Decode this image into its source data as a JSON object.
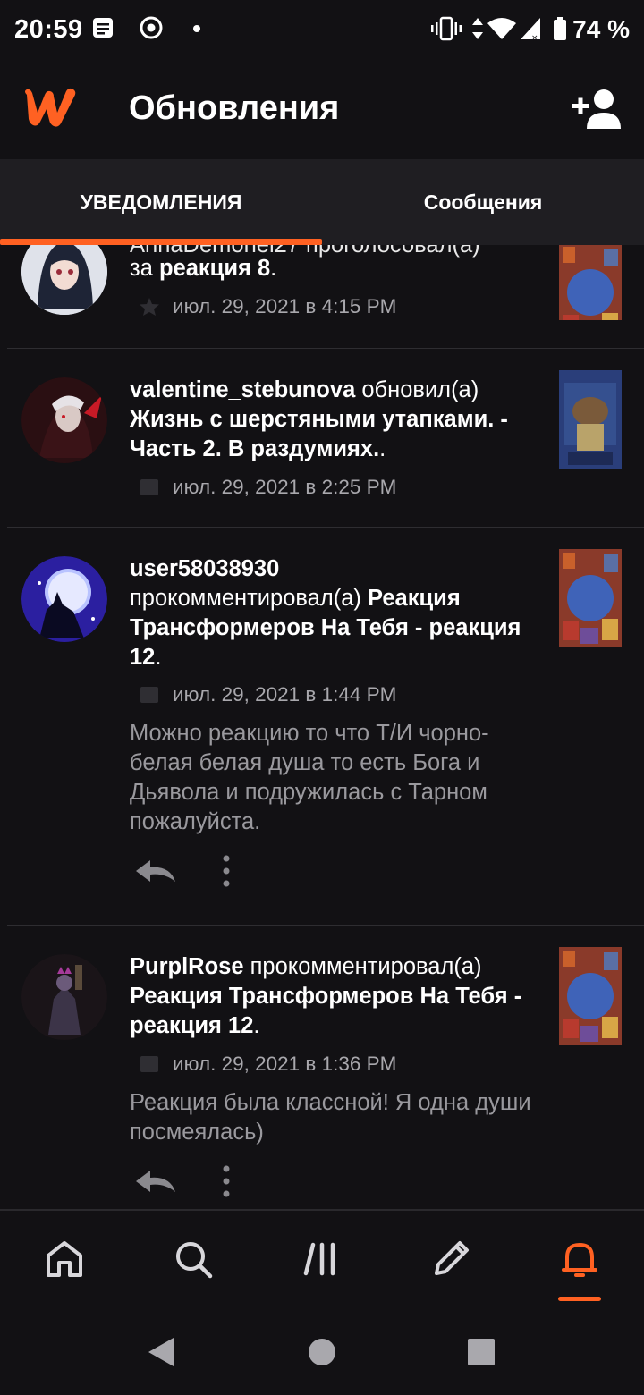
{
  "status_bar": {
    "time": "20:59",
    "battery_percent": "74 %",
    "icons": [
      "notification-icon",
      "chrome-icon",
      "dot-icon",
      "vibrate-icon",
      "data-arrows-icon",
      "wifi-icon",
      "signal-icon",
      "battery-icon"
    ]
  },
  "app_bar": {
    "title": "Обновления",
    "logo": "wattpad-logo",
    "action_icon": "add-user-icon"
  },
  "tabs": [
    {
      "label": "УВЕДОМЛЕНИЯ",
      "active": true
    },
    {
      "label": "Сообщения",
      "active": false
    }
  ],
  "notifications": [
    {
      "partial_top_text": "AnnaDemonel27 проголосовал(а)",
      "prefix": "за",
      "title": "реакция 8",
      "suffix": ".",
      "timestamp": "июл. 29, 2021 в 4:15 PM",
      "meta_icon": "star-icon"
    },
    {
      "user": "valentine_stebunova",
      "action": "обновил(а)",
      "title": "Жизнь с шерстяными утапками. - Часть 2. В раздумиях.",
      "suffix": ".",
      "timestamp": "июл. 29, 2021 в 2:25 PM",
      "meta_icon": "book-icon"
    },
    {
      "user": "user58038930",
      "action": "прокомментировал(а)",
      "title": "Реакция Трансформеров На Тебя - реакция 12",
      "suffix": ".",
      "timestamp": "июл. 29, 2021 в 1:44 PM",
      "meta_icon": "comment-icon",
      "comment": "Можно реакцию то что Т/И чорно-белая белая душа то есть Бога и Дьявола и подружилась с Тарном пожалуйста."
    },
    {
      "user": "PurplRose",
      "action": "прокомментировал(а)",
      "title": "Реакция Трансформеров На Тебя - реакция 12",
      "suffix": ".",
      "timestamp": "июл. 29, 2021 в 1:36 PM",
      "meta_icon": "comment-icon",
      "comment": "Реакция была классной! Я одна души посмеялась)"
    }
  ],
  "bottom_nav": [
    {
      "icon": "home-icon",
      "active": false
    },
    {
      "icon": "search-icon",
      "active": false
    },
    {
      "icon": "library-icon",
      "active": false
    },
    {
      "icon": "write-icon",
      "active": false
    },
    {
      "icon": "bell-icon",
      "active": true
    }
  ],
  "colors": {
    "accent": "#ff6122",
    "background": "#121114",
    "tab_bar": "#1f1e22"
  }
}
